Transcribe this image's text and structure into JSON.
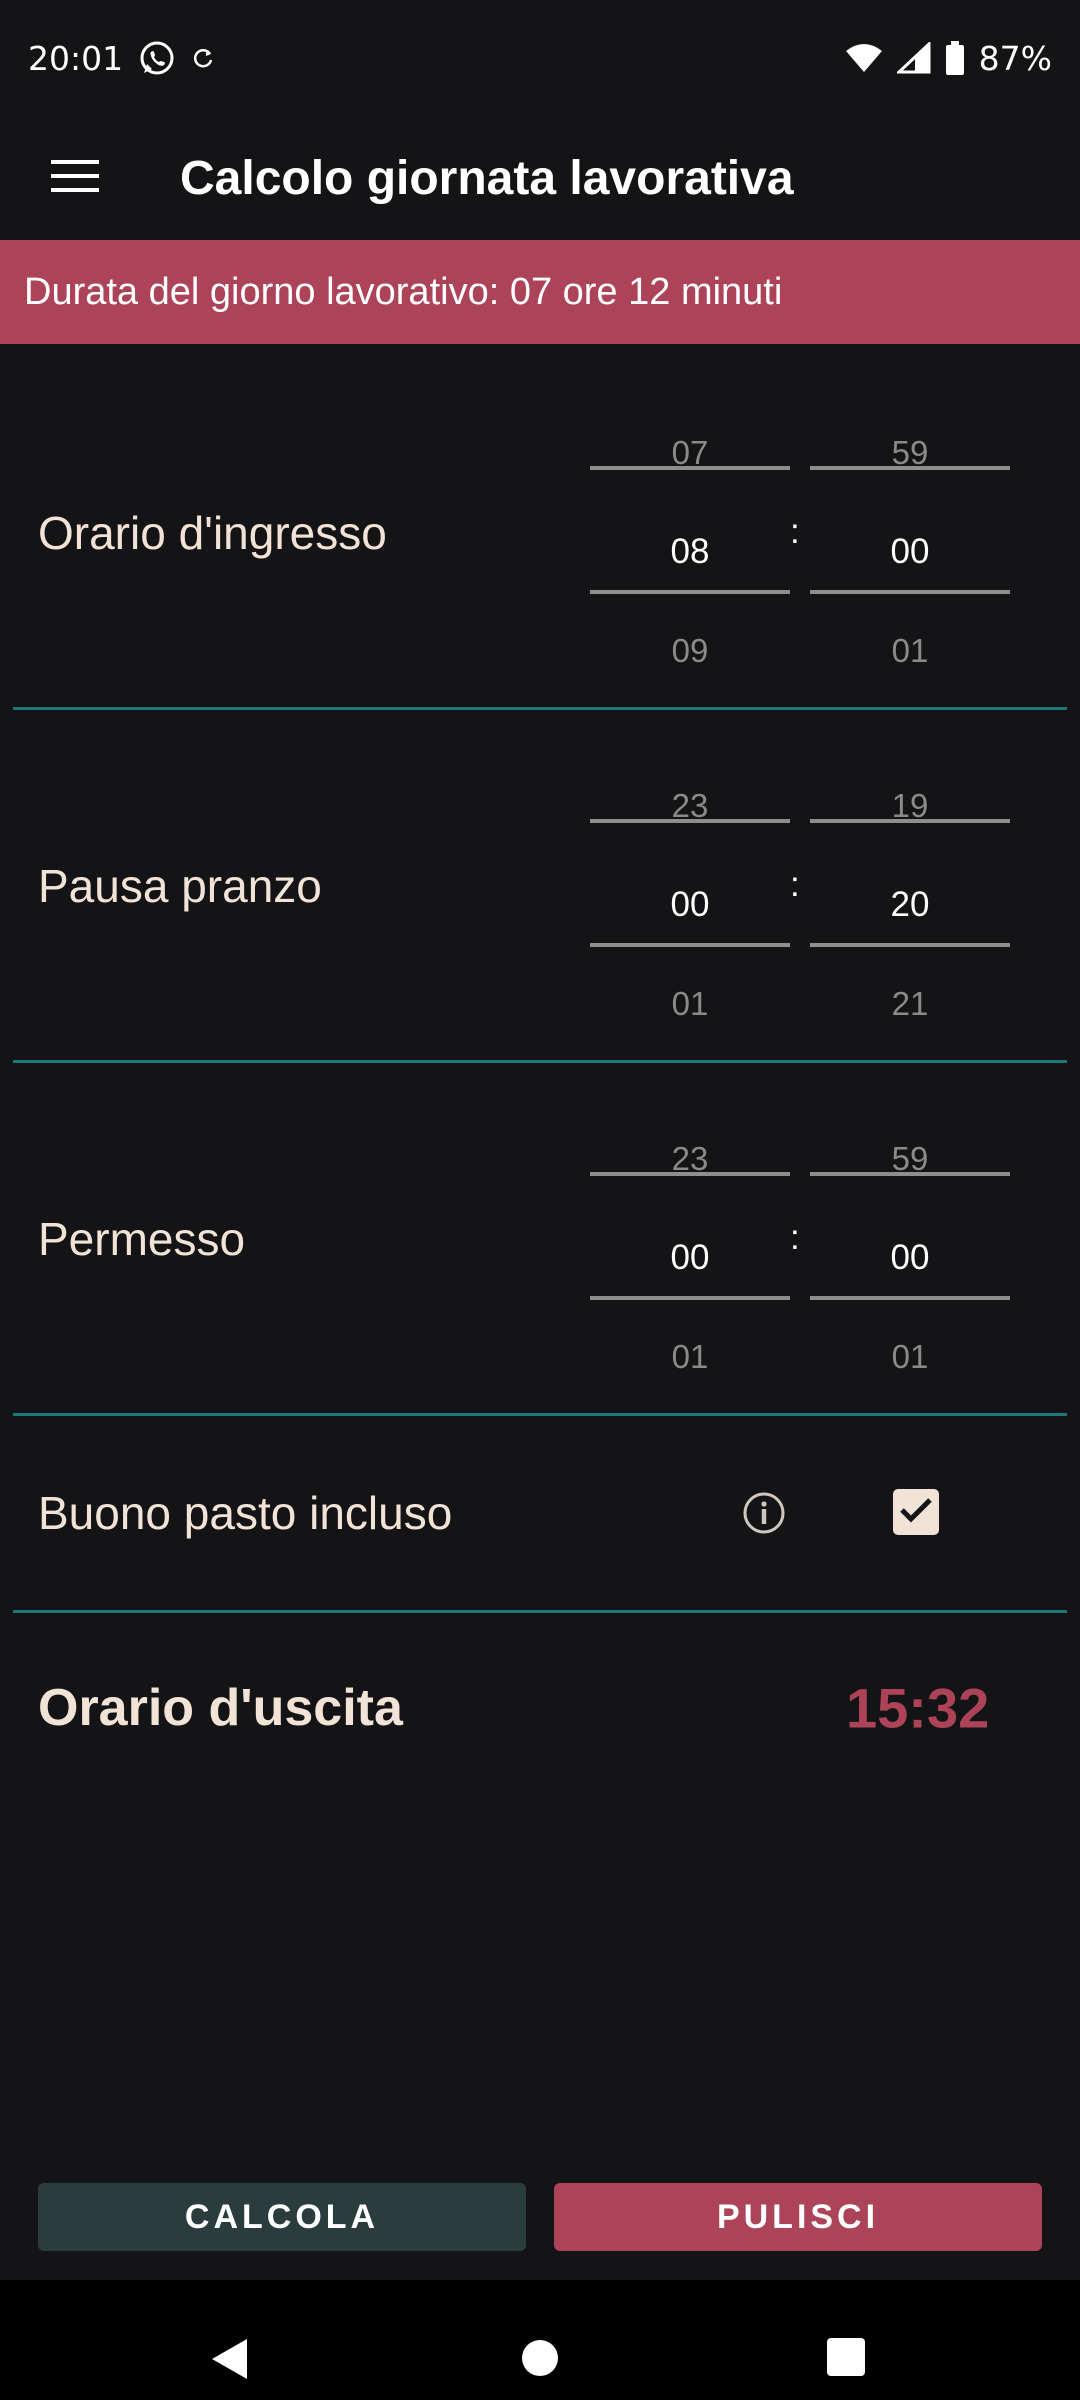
{
  "status_bar": {
    "time": "20:01",
    "icons_left": [
      "whatsapp-icon",
      "sync-icon"
    ],
    "icons_right": [
      "wifi-icon",
      "signal-icon",
      "battery-icon"
    ],
    "battery": "87%"
  },
  "app_bar": {
    "menu_icon": "menu-icon",
    "title": "Calcolo giornata lavorativa"
  },
  "banner": {
    "text": "Durata del giorno lavorativo: 07 ore 12 minuti"
  },
  "rows": {
    "ingresso": {
      "label": "Orario d'ingresso",
      "hours": {
        "prev": "07",
        "value": "08",
        "next": "09"
      },
      "minutes": {
        "prev": "59",
        "value": "00",
        "next": "01"
      }
    },
    "pausa": {
      "label": "Pausa pranzo",
      "hours": {
        "prev": "23",
        "value": "00",
        "next": "01"
      },
      "minutes": {
        "prev": "19",
        "value": "20",
        "next": "21"
      }
    },
    "permesso": {
      "label": "Permesso",
      "hours": {
        "prev": "23",
        "value": "00",
        "next": "01"
      },
      "minutes": {
        "prev": "59",
        "value": "00",
        "next": "01"
      }
    }
  },
  "time_separator": ":",
  "meal_voucher": {
    "label": "Buono pasto incluso",
    "info_icon": "info-icon",
    "checked": true
  },
  "exit": {
    "label": "Orario d'uscita",
    "value": "15:32"
  },
  "buttons": {
    "calc": "CALCOLA",
    "clear": "PULISCI"
  },
  "colors": {
    "accent": "#ad4358",
    "background": "#141416",
    "divider": "#1d7a7a",
    "calc_button": "#2b3c3d",
    "text": "#f1e3d6"
  },
  "nav_bar": {
    "icons": [
      "back-icon",
      "home-icon",
      "recents-icon"
    ]
  }
}
